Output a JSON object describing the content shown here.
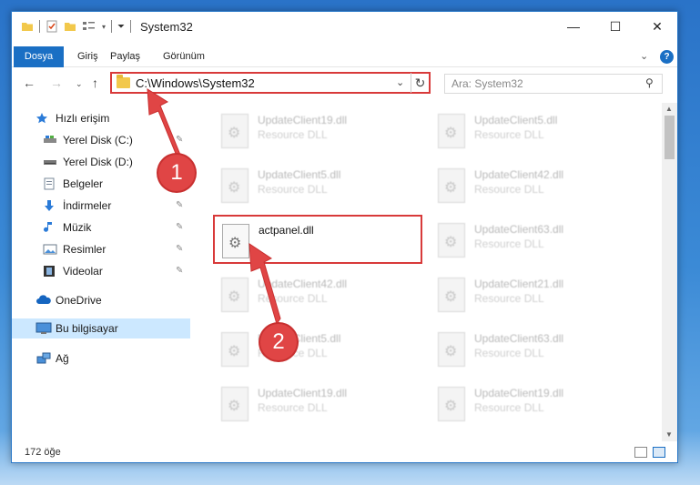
{
  "window": {
    "title": "System32",
    "controls": {
      "minimize": "—",
      "maximize": "☐",
      "close": "✕"
    }
  },
  "ribbon": {
    "tabs": [
      "Dosya",
      "Giriş",
      "Paylaş",
      "Görünüm"
    ],
    "file_color": "#1a6fc4",
    "help": "?"
  },
  "navigation": {
    "back": "←",
    "forward": "→",
    "recent": "⌄",
    "up": "↑",
    "address_path": "C:\\Windows\\System32",
    "address_dropdown": "⌄",
    "refresh": "↻",
    "search_placeholder": "Ara: System32",
    "search_icon": "search-icon"
  },
  "sidebar": {
    "items": [
      {
        "label": "Hızlı erişim",
        "icon": "star-icon",
        "pinned": false
      },
      {
        "label": "Yerel Disk (C:)",
        "icon": "drive-icon",
        "pinned": true
      },
      {
        "label": "Yerel Disk (D:)",
        "icon": "drive-icon",
        "pinned": true
      },
      {
        "label": "Belgeler",
        "icon": "documents-icon",
        "pinned": true
      },
      {
        "label": "İndirmeler",
        "icon": "download-icon",
        "pinned": true
      },
      {
        "label": "Müzik",
        "icon": "music-icon",
        "pinned": true
      },
      {
        "label": "Resimler",
        "icon": "pictures-icon",
        "pinned": true
      },
      {
        "label": "Videolar",
        "icon": "videos-icon",
        "pinned": true
      },
      {
        "label": "OneDrive",
        "icon": "cloud-icon",
        "pinned": false
      },
      {
        "label": "Bu bilgisayar",
        "icon": "computer-icon",
        "pinned": false,
        "selected": true
      },
      {
        "label": "Ağ",
        "icon": "network-icon",
        "pinned": false
      }
    ],
    "pin_glyph": "📌"
  },
  "files": {
    "left_column": [
      {
        "name": "UpdateClient19.dll",
        "type": "Resource DLL"
      },
      {
        "name": "UpdateClient5.dll",
        "type": "Resource DLL"
      },
      {
        "name": "actpanel.dll",
        "type": ""
      },
      {
        "name": "UpdateClient42.dll",
        "type": "Resource DLL"
      },
      {
        "name": "UpdateClient5.dll",
        "type": "Resource DLL"
      },
      {
        "name": "UpdateClient19.dll",
        "type": "Resource DLL"
      }
    ],
    "right_column": [
      {
        "name": "UpdateClient5.dll",
        "type": "Resource DLL"
      },
      {
        "name": "UpdateClient42.dll",
        "type": "Resource DLL"
      },
      {
        "name": "UpdateClient63.dll",
        "type": "Resource DLL"
      },
      {
        "name": "UpdateClient21.dll",
        "type": "Resource DLL"
      },
      {
        "name": "UpdateClient63.dll",
        "type": "Resource DLL"
      },
      {
        "name": "UpdateClient19.dll",
        "type": "Resource DLL"
      }
    ]
  },
  "status": {
    "item_count": "172 öğe"
  },
  "annotations": {
    "callout_1": "1",
    "callout_2": "2",
    "color": "#e04545"
  }
}
